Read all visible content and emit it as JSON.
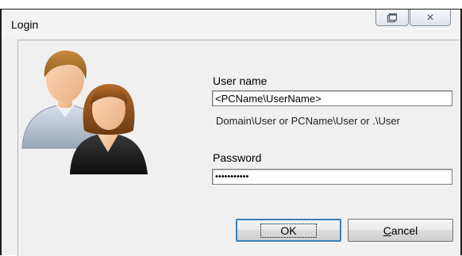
{
  "window": {
    "title": "Login",
    "restore_icon": "restore-icon",
    "close_icon": "close-icon",
    "close_glyph": "✕"
  },
  "form": {
    "username_label": "User name",
    "username_value": "<PCName\\UserName>",
    "username_hint": "Domain\\User or PCName\\User or .\\User",
    "password_label": "Password",
    "password_value": "•••••••••••"
  },
  "buttons": {
    "ok_label": "OK",
    "cancel_label": "Cancel"
  },
  "colors": {
    "dialog_background": "#f0f0f0",
    "default_button_border": "#3c7fb1"
  }
}
